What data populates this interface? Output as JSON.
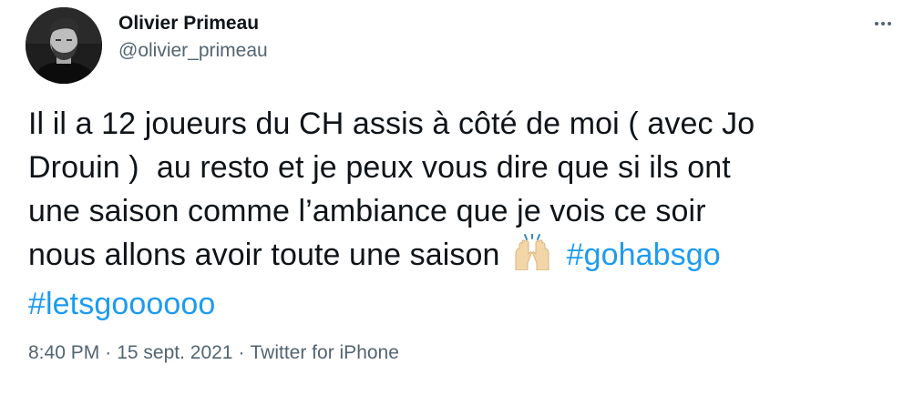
{
  "author": {
    "display_name": "Olivier Primeau",
    "handle": "@olivier_primeau"
  },
  "tweet": {
    "line1": "Il il a 12 joueurs du CH assis à côté de moi ( avec Jo",
    "line2": "Drouin )  au resto et je peux vous dire que si ils ont",
    "line3": "une saison comme l’ambiance que je vois ce soir",
    "line4_text": "nous allons avoir toute une saison",
    "emoji_name": "raising-hands-icon",
    "hashtag1": "#gohabsgo",
    "hashtag2": "#letsgoooooo"
  },
  "meta": {
    "time": "8:40 PM",
    "separator": "·",
    "date": "15 sept. 2021",
    "source": "Twitter for iPhone"
  },
  "colors": {
    "text": "#0f1419",
    "secondary": "#536471",
    "link": "#1d9bf0"
  }
}
